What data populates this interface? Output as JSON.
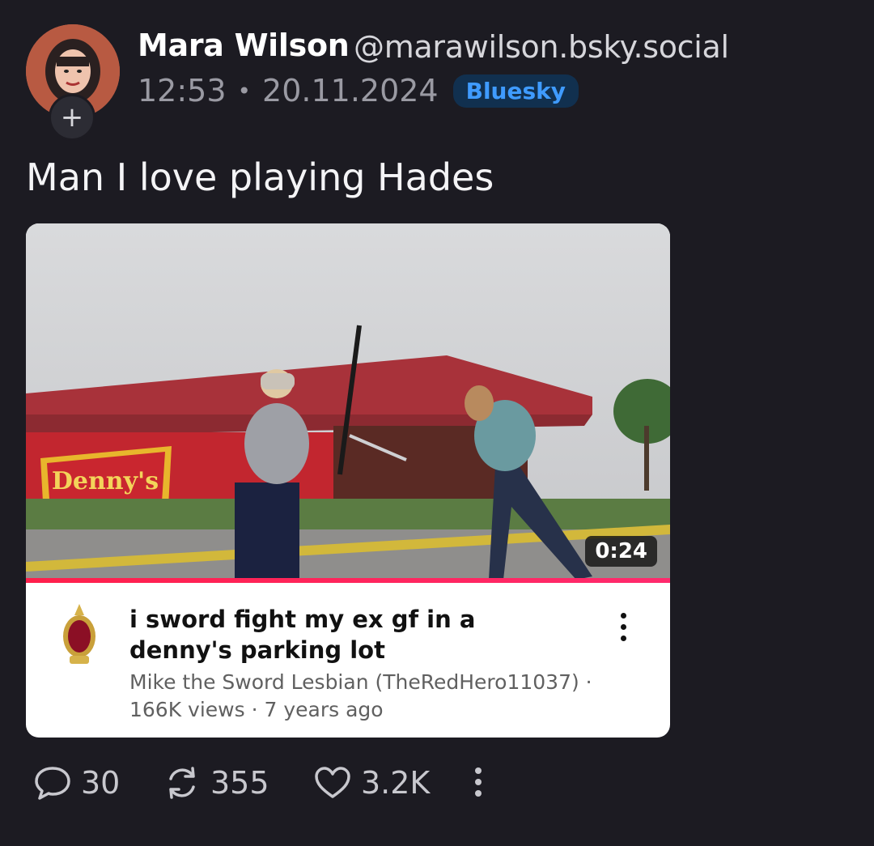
{
  "post": {
    "author_name": "Mara Wilson",
    "author_handle": "@marawilson.bsky.social",
    "time": "12:53",
    "separator": "•",
    "date": "20.11.2024",
    "source_badge": "Bluesky",
    "text": "Man I love playing Hades"
  },
  "embed": {
    "duration": "0:24",
    "title": "i sword fight my ex gf in a denny's parking lot",
    "channel": "Mike the Sword Lesbian (TheRedHero11037) ·",
    "stats": "166K views · 7 years ago",
    "thumbnail_sign_text": "Denny's"
  },
  "actions": {
    "replies": "30",
    "reposts": "355",
    "likes": "3.2K"
  },
  "colors": {
    "background": "#1c1b22",
    "badge_text": "#3f9bff",
    "badge_bg": "#11304f",
    "progress": "#ff1f4b"
  },
  "icons": [
    "follow-plus-icon",
    "reply-icon",
    "repost-icon",
    "like-icon",
    "more-icon"
  ]
}
